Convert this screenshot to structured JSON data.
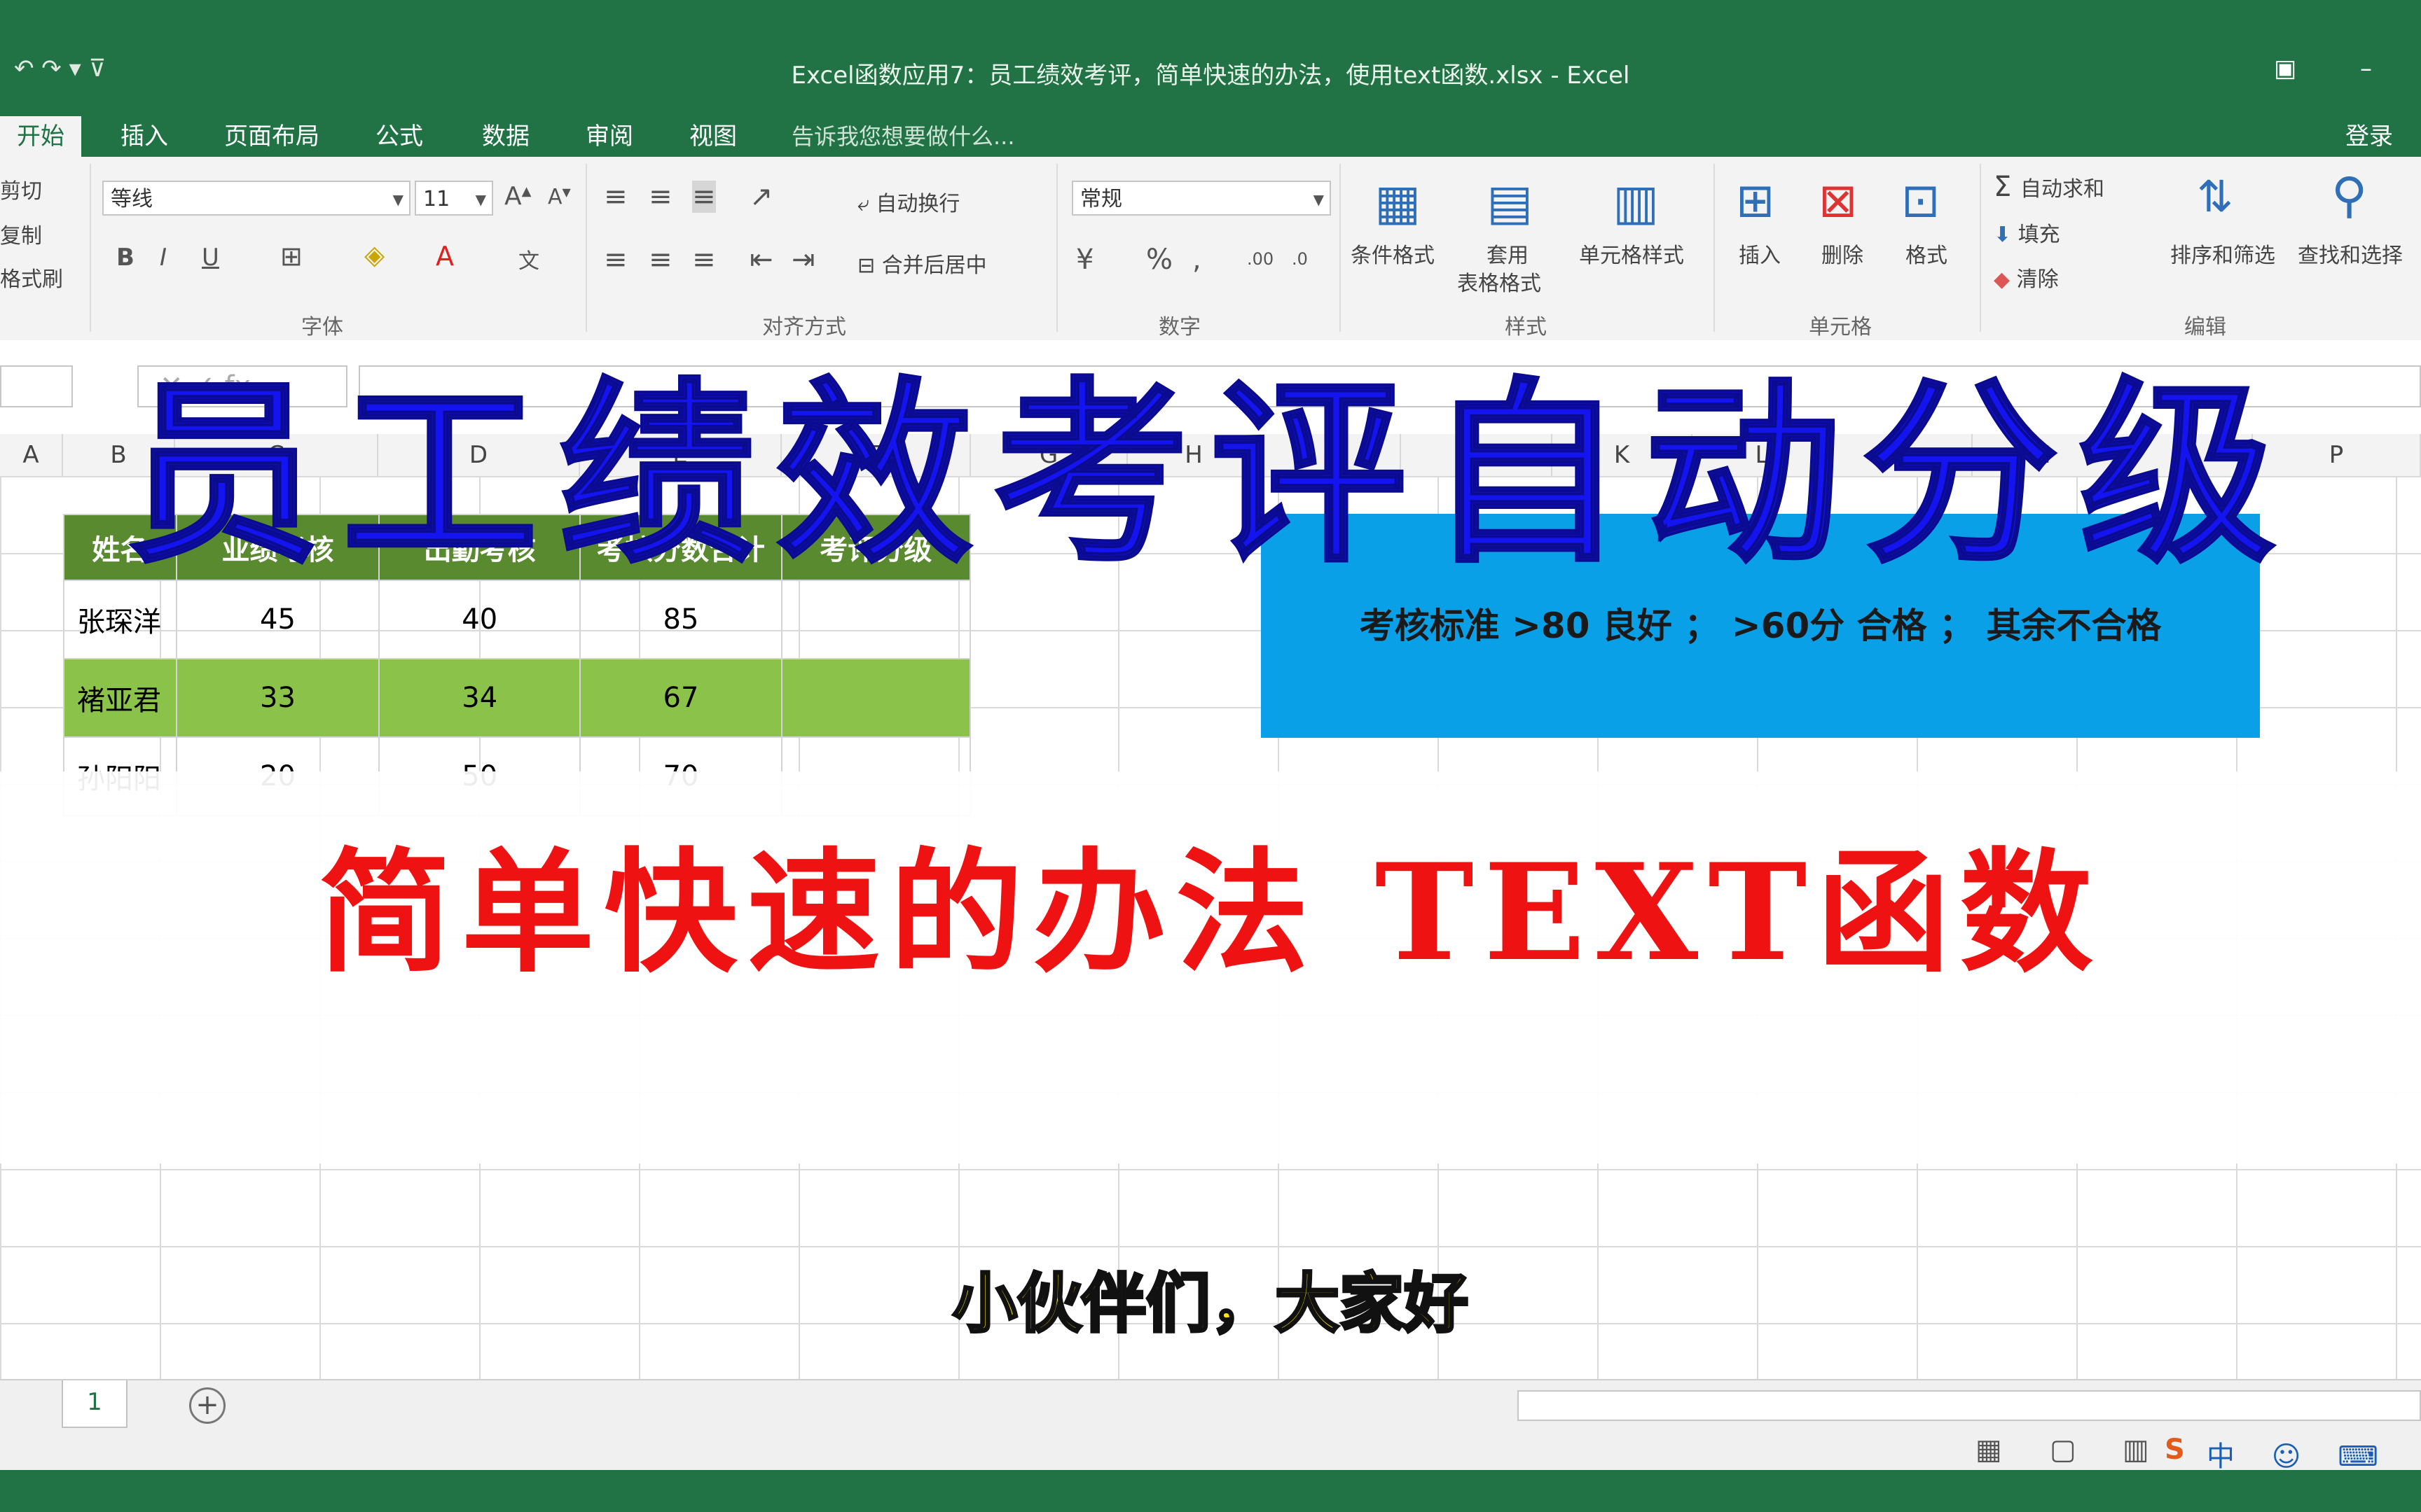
{
  "window": {
    "title": "Excel函数应用7：员工绩效考评，简单快速的办法，使用text函数.xlsx - Excel",
    "quick_access": "↶ ↷ ▾ ⊽",
    "controls": "▣ –"
  },
  "tabs": [
    {
      "label": "开始",
      "active": true
    },
    {
      "label": "插入"
    },
    {
      "label": "页面布局"
    },
    {
      "label": "公式"
    },
    {
      "label": "数据"
    },
    {
      "label": "审阅"
    },
    {
      "label": "视图"
    }
  ],
  "tell_me": "告诉我您想要做什么...",
  "login": "登录",
  "ribbon": {
    "clipboard": {
      "cut": "剪切",
      "copy": "复制",
      "format_painter": "格式刷"
    },
    "font": {
      "name": "等线",
      "size": "11",
      "group": "字体"
    },
    "alignment": {
      "wrap": "自动换行",
      "merge": "合并后居中",
      "group": "对齐方式"
    },
    "number": {
      "format": "常规",
      "group": "数字"
    },
    "styles": {
      "conditional": "条件格式",
      "table_fmt_1": "套用",
      "table_fmt_2": "表格格式",
      "cell_styles": "单元格样式",
      "group": "样式"
    },
    "cells": {
      "insert": "插入",
      "delete": "删除",
      "format": "格式",
      "group": "单元格"
    },
    "editing": {
      "autosum": "自动求和",
      "fill": "填充",
      "clear": "清除",
      "sort": "排序和筛选",
      "find": "查找和选择",
      "group": "编辑"
    }
  },
  "columns": [
    "A",
    "B",
    "C",
    "D",
    "E",
    "F",
    "G",
    "H",
    "I",
    "J",
    "K",
    "L",
    "M",
    "N",
    "O",
    "P"
  ],
  "table": {
    "headers": [
      "姓名",
      "业绩考核",
      "出勤考核",
      "考核分数合计",
      "考评分级"
    ],
    "rows": [
      [
        "张琛洋",
        "45",
        "40",
        "85",
        ""
      ],
      [
        "褚亚君",
        "33",
        "34",
        "67",
        ""
      ],
      [
        "孙阳阳",
        "20",
        "50",
        "70",
        ""
      ]
    ]
  },
  "criteria": "考核标准  >80 良好 ； >60分 合格 ； 其余不合格",
  "overlay": {
    "headline": "员工绩效考评自动分级",
    "subline": "简单快速的办法 TEXT函数",
    "caption": "小伙伴们，大家好"
  },
  "sheet_tab": "1",
  "colors": {
    "excel_green": "#217346",
    "header_green": "#5a8a2f",
    "highlight_green": "#8bc34a",
    "criteria_blue": "#0aa0e8",
    "headline_blue": "#1414f0",
    "subline_red": "#ee1212",
    "caption_yellow": "#ffe800"
  }
}
